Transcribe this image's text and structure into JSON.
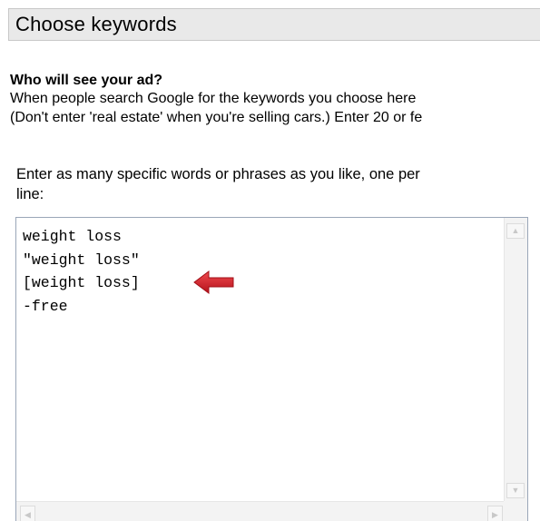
{
  "header": {
    "title": "Choose keywords"
  },
  "intro": {
    "heading": "Who will see your ad?",
    "line1": "When people search Google for the keywords you choose here",
    "line2": "(Don't enter 'real estate' when you're selling cars.) Enter 20 or fe"
  },
  "keywords_field": {
    "prompt_line1": "Enter as many specific words or phrases as you like, one per",
    "prompt_line2": "line:",
    "lines": [
      "weight loss",
      "\"weight loss\"",
      "[weight loss]",
      "-free"
    ]
  },
  "annotation": {
    "arrow_color": "#d41f26",
    "arrow_icon": "left-arrow-icon"
  },
  "colors": {
    "header_bg": "#e9e9e9",
    "textarea_border": "#9aa6b8"
  }
}
